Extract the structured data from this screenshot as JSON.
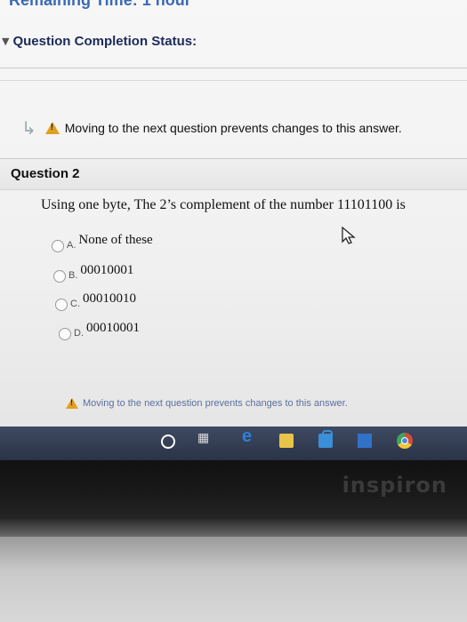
{
  "header": {
    "top_cut_text": "Remaining Time: 1 hour",
    "status_label": "Question Completion Status:"
  },
  "notice": {
    "text": "Moving to the next question prevents changes to this answer."
  },
  "question": {
    "title": "Question 2",
    "prompt": "Using one byte, The 2’s complement of the number 11101100 is",
    "options": [
      {
        "letter": "A.",
        "text": "None of these"
      },
      {
        "letter": "B.",
        "text": "00010001"
      },
      {
        "letter": "C.",
        "text": "00010010"
      },
      {
        "letter": "D.",
        "text": "00010001"
      }
    ]
  },
  "footer_notice": {
    "text": "Moving to the next question prevents changes to this answer."
  },
  "taskbar": {
    "icons": [
      "cortana-icon",
      "task-view-icon",
      "edge-icon",
      "file-explorer-icon",
      "store-icon",
      "mail-icon",
      "chrome-icon"
    ],
    "task_view_glyph": "▦",
    "edge_glyph": "e"
  },
  "device": {
    "brand": "inspiron"
  },
  "colors": {
    "warning": "#e0a020",
    "status_label": "#1c2a5a",
    "taskbar": "#2a3346"
  }
}
